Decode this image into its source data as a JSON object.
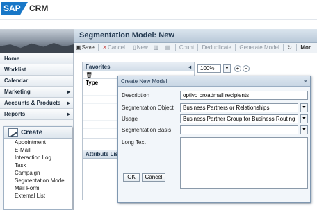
{
  "app": {
    "logo": "SAP",
    "product": "CRM"
  },
  "header": {
    "title": "Segmentation Model: New"
  },
  "toolbar": {
    "items": [
      {
        "label": "Save",
        "icon": "save-icon",
        "enabled": true
      },
      {
        "label": "Cancel",
        "icon": "cancel-icon",
        "enabled": false
      },
      {
        "label": "New",
        "icon": "new-document-icon",
        "enabled": false
      },
      {
        "label": "",
        "icon": "delete-icon",
        "enabled": false
      },
      {
        "label": "",
        "icon": "copy-icon",
        "enabled": false
      },
      {
        "label": "Count",
        "icon": "",
        "enabled": false
      },
      {
        "label": "Deduplicate",
        "icon": "",
        "enabled": false
      },
      {
        "label": "Generate Model",
        "icon": "",
        "enabled": false
      },
      {
        "label": "",
        "icon": "refresh-icon",
        "enabled": true
      },
      {
        "label": "Mor",
        "icon": "",
        "enabled": true
      }
    ]
  },
  "sidebar": {
    "items": [
      {
        "label": "Home",
        "arrow": ""
      },
      {
        "label": "Worklist",
        "arrow": ""
      },
      {
        "label": "Calendar",
        "arrow": ""
      },
      {
        "label": "Marketing",
        "arrow": "▸"
      },
      {
        "label": "Accounts & Products",
        "arrow": "▸"
      },
      {
        "label": "Reports",
        "arrow": "▸"
      }
    ]
  },
  "create_menu": {
    "title": "Create",
    "items": [
      "Appointment",
      "E-Mail",
      "Interaction Log",
      "Task",
      "Campaign",
      "Segmentation Model",
      "Mail Form",
      "External List"
    ]
  },
  "left_panel": {
    "favorites": "Favorites",
    "type": "Type",
    "attribute_list": "Attribute Lis"
  },
  "zoom": {
    "value": "100%"
  },
  "dialog": {
    "title": "Create New Model",
    "fields": [
      {
        "label": "Description",
        "value": "optivo broadmail recipients"
      },
      {
        "label": "Segmentation Object",
        "value": "Business Partners or Relationships"
      },
      {
        "label": "Usage",
        "value": "Business Partner Group for Business Routing"
      },
      {
        "label": "Segmentation Basis",
        "value": ""
      },
      {
        "label": "Long Text",
        "value": ""
      }
    ],
    "ok": "OK",
    "cancel": "Cancel"
  },
  "colors": {
    "brand": "#1877c7",
    "accent": "#253b52"
  }
}
